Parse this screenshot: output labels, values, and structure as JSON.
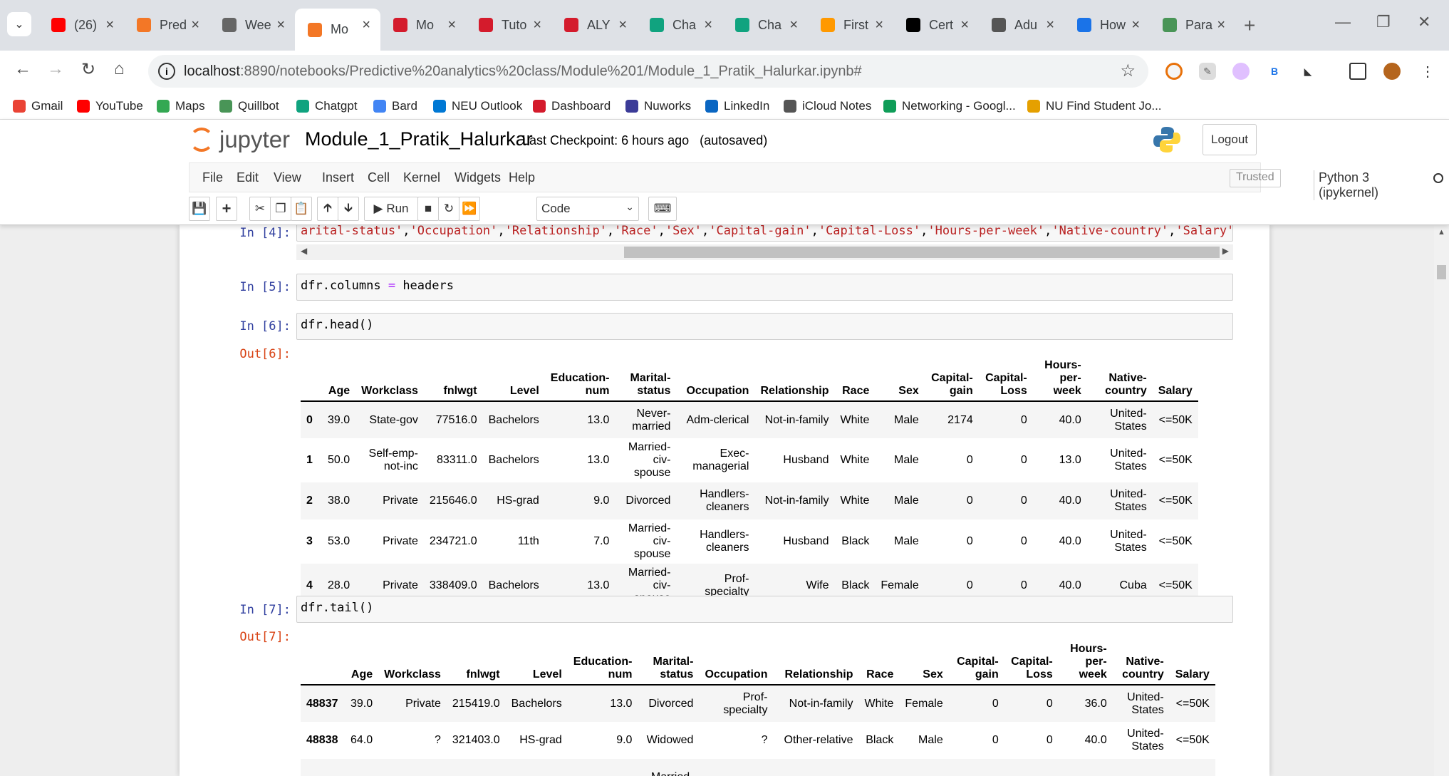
{
  "browser": {
    "tabs": [
      {
        "title": "(26)",
        "icon": "youtube-icon",
        "color": "#ff0000"
      },
      {
        "title": "Pred",
        "icon": "jupyter-icon",
        "color": "#f37726"
      },
      {
        "title": "Wee",
        "icon": "canvas-icon",
        "color": "#666666"
      },
      {
        "title": "Mo",
        "icon": "jupyter-notebook-icon",
        "color": "#f37726"
      },
      {
        "title": "Mo",
        "icon": "northeastern-icon",
        "color": "#d41b2c"
      },
      {
        "title": "Tuto",
        "icon": "northeastern-icon",
        "color": "#d41b2c"
      },
      {
        "title": "ALY",
        "icon": "northeastern-icon",
        "color": "#d41b2c"
      },
      {
        "title": "Cha",
        "icon": "chatgpt-icon",
        "color": "#10a37f"
      },
      {
        "title": "Cha",
        "icon": "chatgpt-icon",
        "color": "#10a37f"
      },
      {
        "title": "First",
        "icon": "chart-icon",
        "color": "#ff9900"
      },
      {
        "title": "Cert",
        "icon": "coursera-icon",
        "color": "#000000"
      },
      {
        "title": "Adu",
        "icon": "dataset-icon",
        "color": "#555555"
      },
      {
        "title": "How",
        "icon": "k-icon",
        "color": "#1a73e8"
      },
      {
        "title": "Para",
        "icon": "quillbot-icon",
        "color": "#499557"
      }
    ],
    "url_host": "localhost",
    "url_rest": ":8890/notebooks/Predictive%20analytics%20class/Module%201/Module_1_Pratik_Halurkar.ipynb#",
    "bookmarks": [
      {
        "label": "Gmail",
        "icon": "gmail-icon",
        "color": "#ea4335"
      },
      {
        "label": "YouTube",
        "icon": "youtube-icon",
        "color": "#ff0000"
      },
      {
        "label": "Maps",
        "icon": "maps-icon",
        "color": "#34a853"
      },
      {
        "label": "Quillbot",
        "icon": "quillbot-icon",
        "color": "#499557"
      },
      {
        "label": "Chatgpt",
        "icon": "chatgpt-icon",
        "color": "#10a37f"
      },
      {
        "label": "Bard",
        "icon": "bard-icon",
        "color": "#4285f4"
      },
      {
        "label": "NEU Outlook",
        "icon": "outlook-icon",
        "color": "#0078d4"
      },
      {
        "label": "Dashboard",
        "icon": "northeastern-icon",
        "color": "#d41b2c"
      },
      {
        "label": "Nuworks",
        "icon": "nuworks-icon",
        "color": "#3b3b98"
      },
      {
        "label": "LinkedIn",
        "icon": "linkedin-icon",
        "color": "#0a66c2"
      },
      {
        "label": "iCloud Notes",
        "icon": "apple-icon",
        "color": "#555555"
      },
      {
        "label": "Networking - Googl...",
        "icon": "sheets-icon",
        "color": "#0f9d58"
      },
      {
        "label": "NU Find Student Jo...",
        "icon": "w-icon",
        "color": "#e5a000"
      }
    ]
  },
  "jupyter": {
    "logo_text": "jupyter",
    "notebook_name": "Module_1_Pratik_Halurkar",
    "checkpoint": "Last Checkpoint: 6 hours ago",
    "autosaved": "(autosaved)",
    "logout": "Logout",
    "menu": [
      "File",
      "Edit",
      "View",
      "Insert",
      "Cell",
      "Kernel",
      "Widgets",
      "Help"
    ],
    "trusted": "Trusted",
    "kernel": "Python 3 (ipykernel)",
    "run_label": "Run",
    "cell_type": "Code"
  },
  "cells": {
    "c4": {
      "prompt": "In [4]:",
      "tokens": [
        "arital-status'",
        "'Occupation'",
        "'Relationship'",
        "'Race'",
        "'Sex'",
        "'Capital-gain'",
        "'Capital-Loss'",
        "'Hours-per-week'",
        "'Native-country'",
        "'Salary'"
      ]
    },
    "c5": {
      "prompt": "In [5]:",
      "lhs": "dfr.columns ",
      "op": "=",
      "rhs": " headers"
    },
    "c6": {
      "prompt": "In [6]:",
      "code": "dfr.head()",
      "out_prompt": "Out[6]:"
    },
    "c7": {
      "prompt": "In [7]:",
      "code": "dfr.tail()",
      "out_prompt": "Out[7]:"
    }
  },
  "head_table": {
    "columns": [
      "Age",
      "Workclass",
      "fnlwgt",
      "Level",
      "Education-num",
      "Marital-status",
      "Occupation",
      "Relationship",
      "Race",
      "Sex",
      "Capital-gain",
      "Capital-Loss",
      "Hours-per-week",
      "Native-country",
      "Salary"
    ],
    "rows": [
      {
        "index": "0",
        "values": [
          "39.0",
          "State-gov",
          "77516.0",
          "Bachelors",
          "13.0",
          "Never-married",
          "Adm-clerical",
          "Not-in-family",
          "White",
          "Male",
          "2174",
          "0",
          "40.0",
          "United-States",
          "<=50K"
        ]
      },
      {
        "index": "1",
        "values": [
          "50.0",
          "Self-emp-not-inc",
          "83311.0",
          "Bachelors",
          "13.0",
          "Married-civ-spouse",
          "Exec-managerial",
          "Husband",
          "White",
          "Male",
          "0",
          "0",
          "13.0",
          "United-States",
          "<=50K"
        ]
      },
      {
        "index": "2",
        "values": [
          "38.0",
          "Private",
          "215646.0",
          "HS-grad",
          "9.0",
          "Divorced",
          "Handlers-cleaners",
          "Not-in-family",
          "White",
          "Male",
          "0",
          "0",
          "40.0",
          "United-States",
          "<=50K"
        ]
      },
      {
        "index": "3",
        "values": [
          "53.0",
          "Private",
          "234721.0",
          "11th",
          "7.0",
          "Married-civ-spouse",
          "Handlers-cleaners",
          "Husband",
          "Black",
          "Male",
          "0",
          "0",
          "40.0",
          "United-States",
          "<=50K"
        ]
      },
      {
        "index": "4",
        "values": [
          "28.0",
          "Private",
          "338409.0",
          "Bachelors",
          "13.0",
          "Married-civ-spouse",
          "Prof-specialty",
          "Wife",
          "Black",
          "Female",
          "0",
          "0",
          "40.0",
          "Cuba",
          "<=50K"
        ]
      }
    ]
  },
  "tail_table": {
    "columns": [
      "Age",
      "Workclass",
      "fnlwgt",
      "Level",
      "Education-num",
      "Marital-status",
      "Occupation",
      "Relationship",
      "Race",
      "Sex",
      "Capital-gain",
      "Capital-Loss",
      "Hours-per-week",
      "Native-country",
      "Salary"
    ],
    "rows": [
      {
        "index": "48837",
        "values": [
          "39.0",
          "Private",
          "215419.0",
          "Bachelors",
          "13.0",
          "Divorced",
          "Prof-specialty",
          "Not-in-family",
          "White",
          "Female",
          "0",
          "0",
          "36.0",
          "United-States",
          "<=50K"
        ]
      },
      {
        "index": "48838",
        "values": [
          "64.0",
          "?",
          "321403.0",
          "HS-grad",
          "9.0",
          "Widowed",
          "?",
          "Other-relative",
          "Black",
          "Male",
          "0",
          "0",
          "40.0",
          "United-States",
          "<=50K"
        ]
      },
      {
        "index": "",
        "values": [
          "",
          "",
          "",
          "",
          "",
          "Married-",
          "",
          "",
          "",
          "",
          "",
          "",
          "",
          "",
          ""
        ]
      }
    ]
  }
}
